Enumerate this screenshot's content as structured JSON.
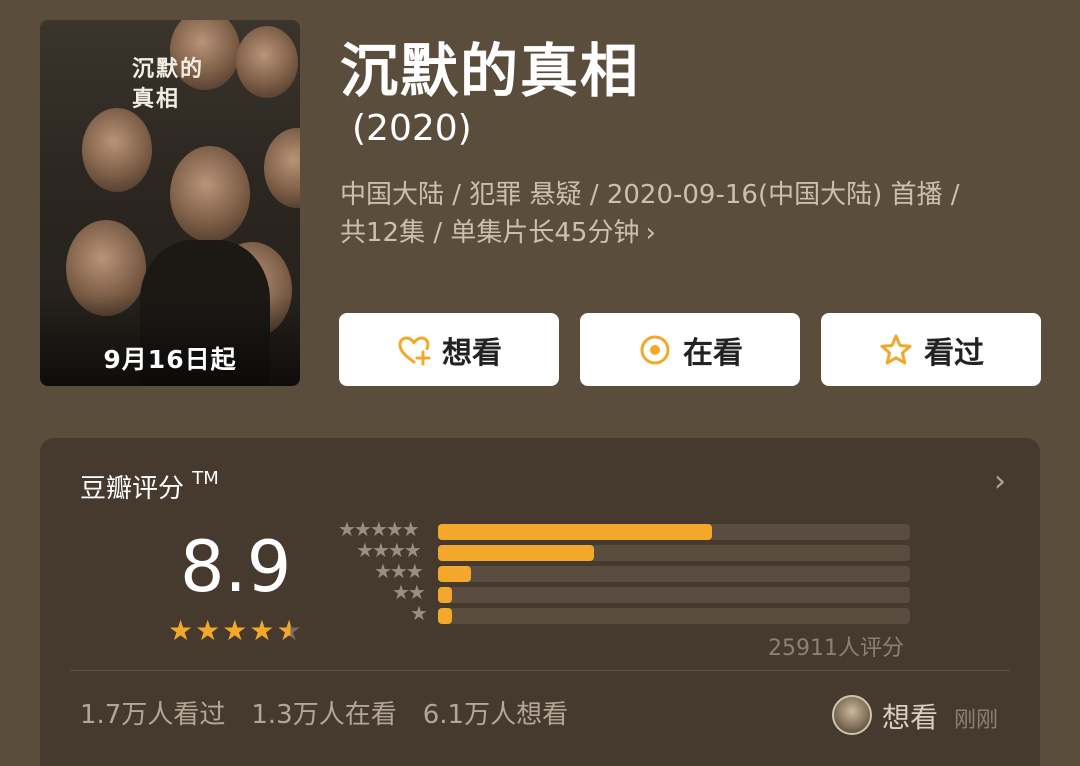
{
  "poster": {
    "title_art": "沉默的真相",
    "release_note": "9月16日起"
  },
  "title": "沉默的真相",
  "year": "(2020)",
  "meta": {
    "line1": "中国大陆 / 犯罪 悬疑 / 2020-09-16(中国大陆) 首播 /",
    "line2": "共12集 / 单集片长45分钟",
    "chevron": "›"
  },
  "actions": {
    "want": {
      "label": "想看",
      "icon": "heart-plus-icon"
    },
    "watching": {
      "label": "在看",
      "icon": "target-circle-icon"
    },
    "watched": {
      "label": "看过",
      "icon": "star-outline-icon"
    }
  },
  "rating_card": {
    "title": "豆瓣评分",
    "tm": "TM",
    "chevron": "›",
    "score": "8.9",
    "stars": 4.5,
    "distribution": [
      {
        "stars": 5,
        "fraction": 0.58
      },
      {
        "stars": 4,
        "fraction": 0.33
      },
      {
        "stars": 3,
        "fraction": 0.07
      },
      {
        "stars": 2,
        "fraction": 0.03
      },
      {
        "stars": 1,
        "fraction": 0.03
      }
    ],
    "rating_count": "25911人评分",
    "stats": {
      "watched": "1.7万人看过",
      "watching": "1.3万人在看",
      "want": "6.1万人想看"
    },
    "friend_activity": {
      "action": "想看",
      "time": "刚刚"
    }
  },
  "colors": {
    "background": "#5b4d3c",
    "card": "#463a2e",
    "accent": "#f4a82b"
  }
}
